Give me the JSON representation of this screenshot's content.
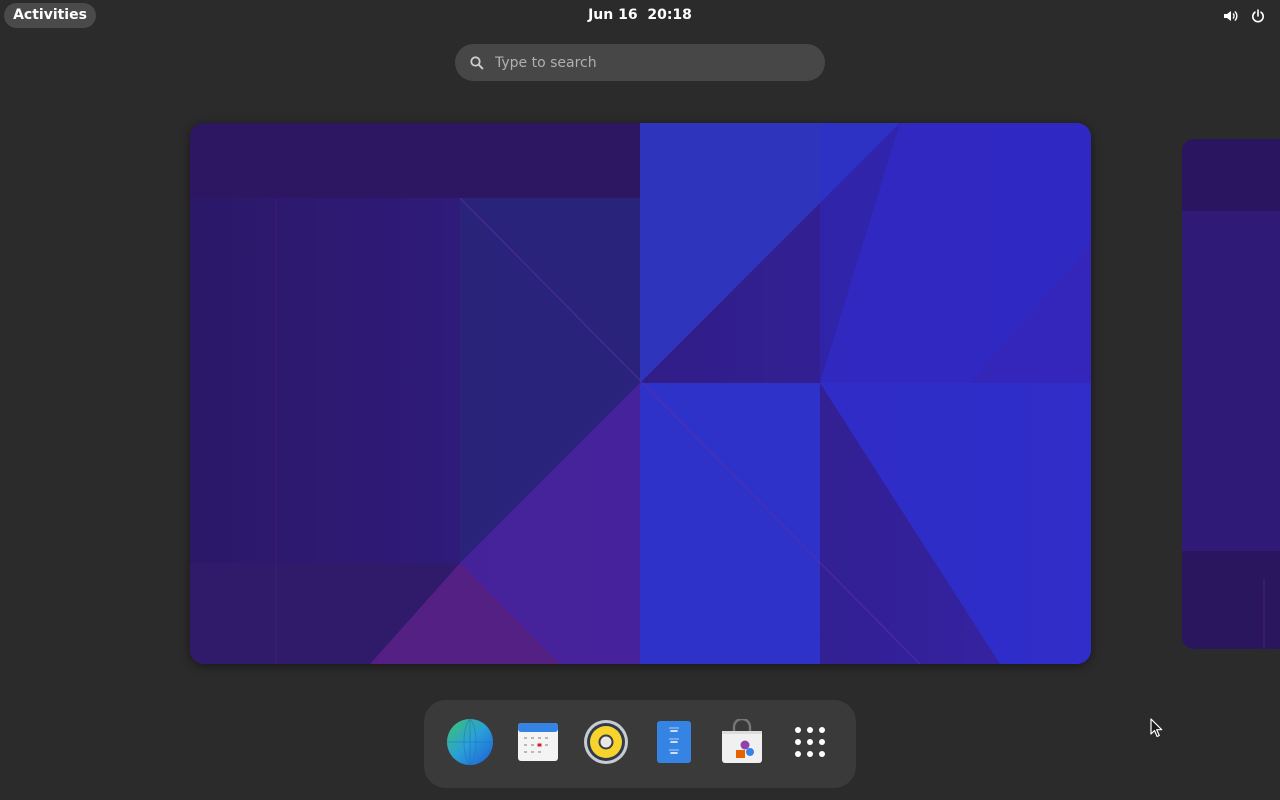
{
  "topbar": {
    "activities_label": "Activities",
    "clock": "Jun 16  20:18",
    "icons": [
      "volume-icon",
      "power-icon"
    ]
  },
  "search": {
    "placeholder": "Type to search",
    "value": ""
  },
  "workspaces": {
    "wallpaper_colors": [
      "#2a1666",
      "#3b21a8",
      "#2b2ee0",
      "#5a1f7a"
    ]
  },
  "dash": {
    "apps": [
      {
        "icon": "web-browser-icon"
      },
      {
        "icon": "calendar-icon"
      },
      {
        "icon": "music-player-icon"
      },
      {
        "icon": "text-editor-icon"
      },
      {
        "icon": "software-store-icon"
      },
      {
        "icon": "show-apps-grid-icon"
      }
    ]
  },
  "colors": {
    "panel_bg": "#2b2b2b",
    "dash_bg": "#3a3a3a",
    "search_bg": "#474747",
    "text": "#ffffff"
  }
}
